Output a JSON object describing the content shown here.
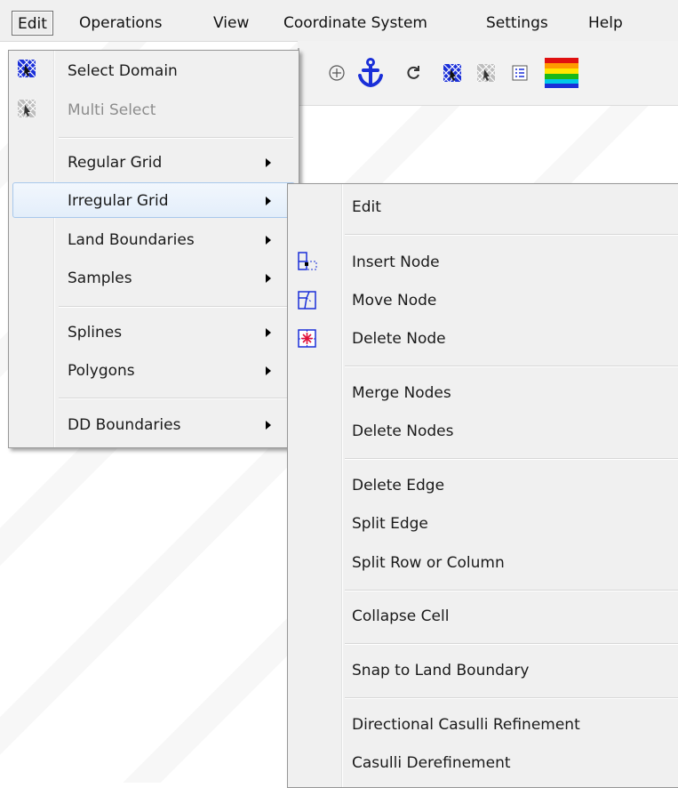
{
  "menubar": {
    "items": [
      "Edit",
      "Operations",
      "View",
      "Coordinate System",
      "Settings",
      "Help"
    ]
  },
  "toolbar": {
    "icons": [
      "zoom-in-icon",
      "anchor-icon",
      "refresh-icon",
      "select-domain-icon",
      "multi-select-icon",
      "legend-icon",
      "color-scale-icon"
    ],
    "anchor_color": "#1a2fd8"
  },
  "edit_menu": {
    "select_domain": "Select Domain",
    "multi_select": "Multi Select",
    "regular_grid": "Regular Grid",
    "irregular_grid": "Irregular Grid",
    "land_boundaries": "Land Boundaries",
    "samples": "Samples",
    "splines": "Splines",
    "polygons": "Polygons",
    "dd_boundaries": "DD Boundaries"
  },
  "irregular_grid_menu": {
    "edit": "Edit",
    "insert_node": "Insert Node",
    "move_node": "Move Node",
    "delete_node": "Delete Node",
    "merge_nodes": "Merge Nodes",
    "delete_nodes": "Delete Nodes",
    "delete_edge": "Delete Edge",
    "split_edge": "Split Edge",
    "split_row_or_column": "Split Row or Column",
    "collapse_cell": "Collapse Cell",
    "snap_to_land_boundary": "Snap to Land Boundary",
    "directional_casulli_refinement": "Directional Casulli Refinement",
    "casulli_derefinement": "Casulli Derefinement"
  },
  "colors": {
    "menu_bg": "#f0f0f0",
    "highlight_border": "#a8c8ec",
    "icon_blue": "#1a2fd8",
    "delete_red": "#e0103a"
  }
}
